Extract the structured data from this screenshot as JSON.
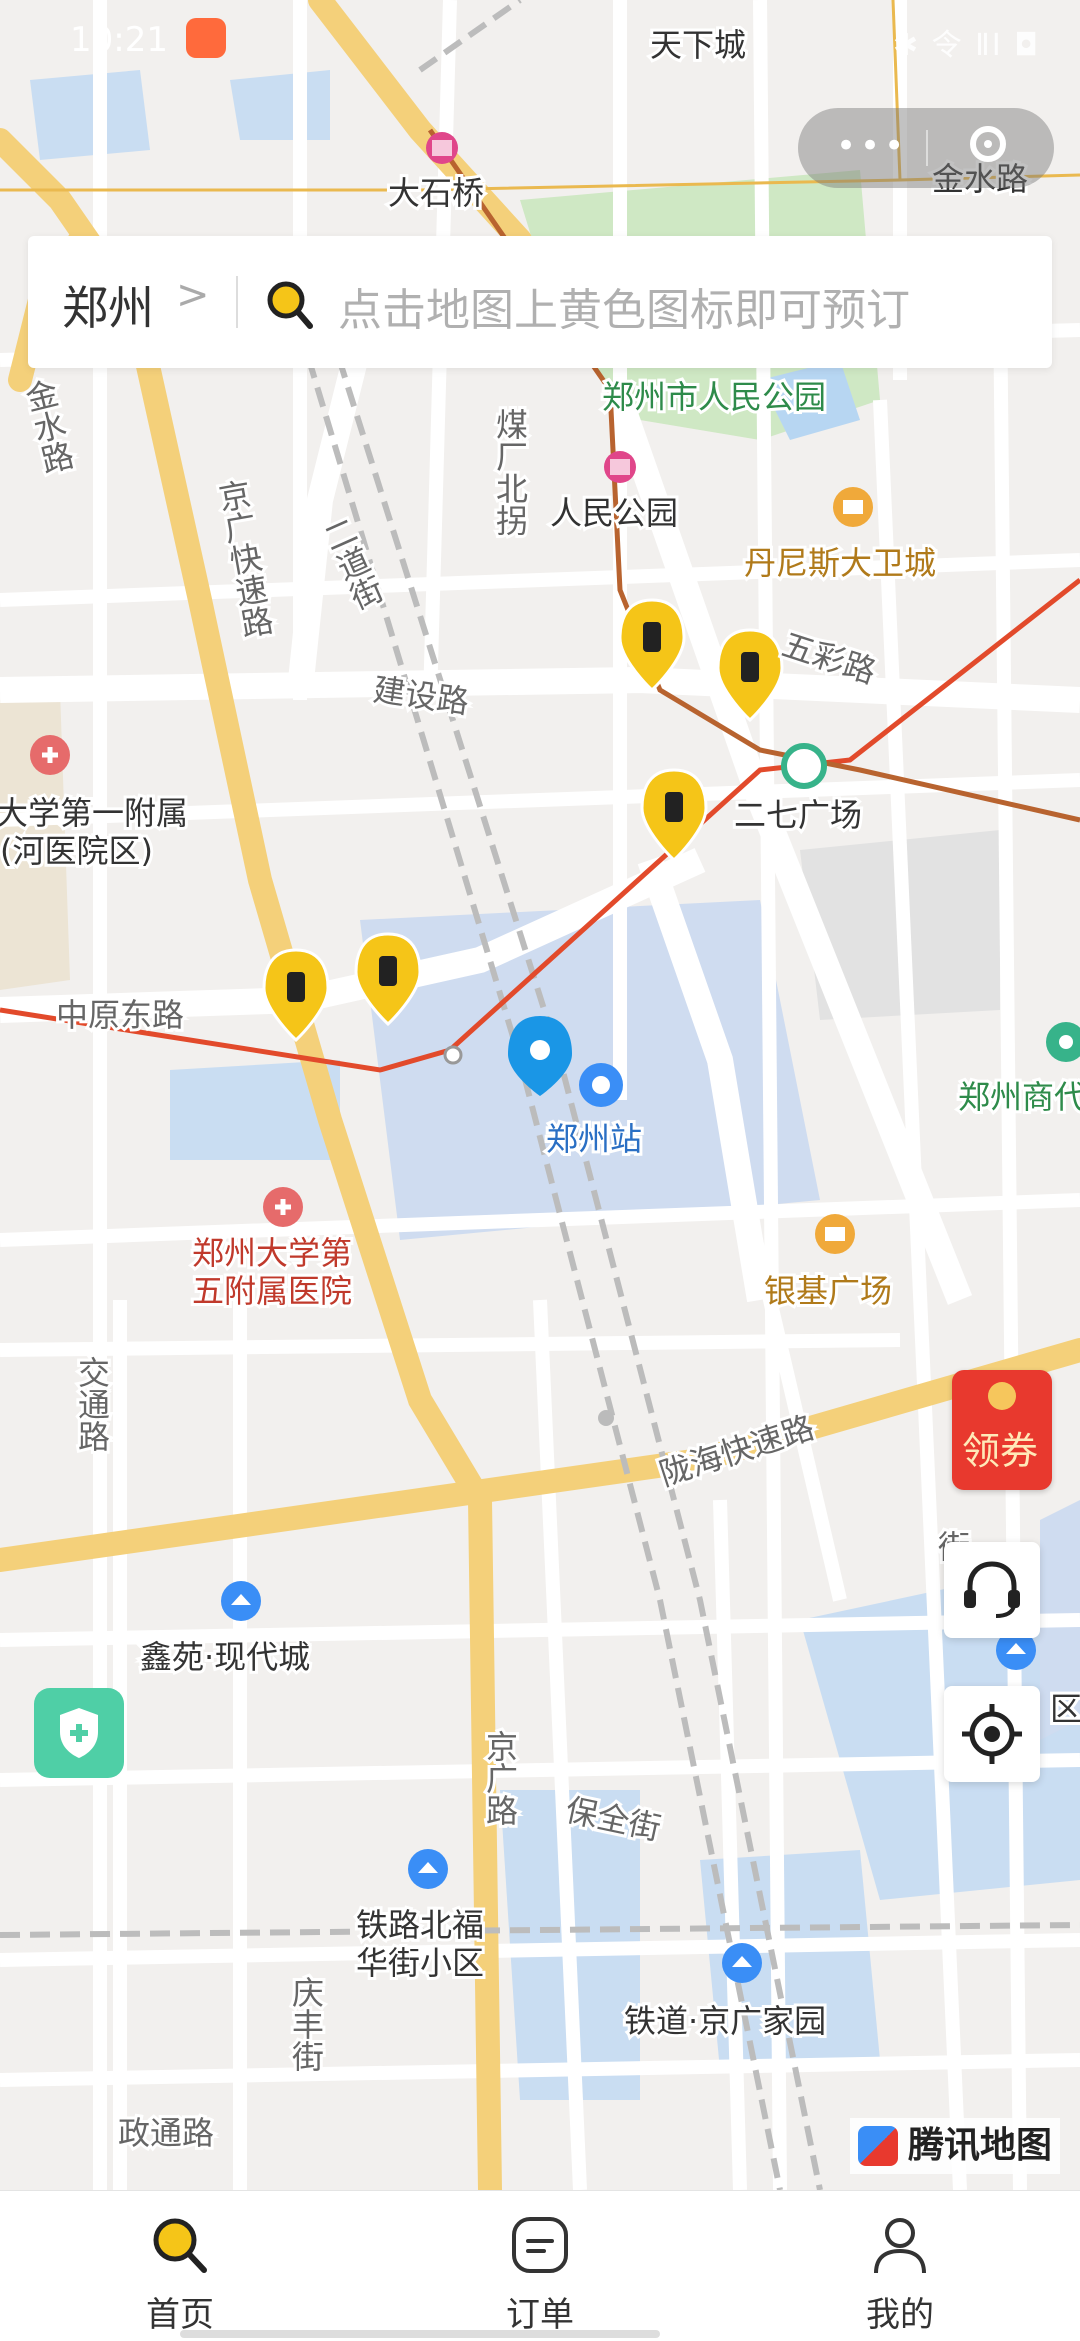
{
  "status_bar": {
    "time": "10:21",
    "right": "✱ 令 ⅡⅠ ◘"
  },
  "search": {
    "city": "郑州",
    "placeholder": "点击地图上黄色图标即可预订"
  },
  "map": {
    "labels": {
      "tianxiacheng": "天下城",
      "jinshuilu_top": "金水路",
      "dashiqiao": "大石桥",
      "renmin_park": "郑州市人民公园",
      "renmin_station": "人民公园",
      "meichang": "煤厂北拐",
      "jinshuilu_left": "金水路",
      "jingguang_expy": "京广快速路",
      "erdaojie": "二道街",
      "dennis": "丹尼斯大卫城",
      "wucailu": "五彩路",
      "jianshelu": "建设路",
      "erqi": "二七广场",
      "hospital1": "大学第一附属",
      "hospital1b": "(河医院区)",
      "zhongyuan": "中原东路",
      "zhengzhou_station": "郑州站",
      "zhengzhou_shang": "郑州商代",
      "hospital5": "郑州大学第",
      "hospital5b": "五附属医院",
      "yinji": "银基广场",
      "jiaotong": "交通路",
      "longhai": "陇海快速路",
      "xinyuan": "鑫苑·现代城",
      "jingguang_rd": "京广路",
      "baoquan": "保全街",
      "tielu1": "铁路北福",
      "tielu2": "华街小区",
      "qingfeng": "庆丰街",
      "tiedao": "铁道·京广家园",
      "zhengtong": "政通路",
      "jie_right": "街",
      "qu_right": "区"
    },
    "lockers_count": 5
  },
  "coupon": {
    "label": "领券"
  },
  "attribution": {
    "label": "腾讯地图"
  },
  "icons": {
    "service": "headset-icon",
    "locate": "locate-icon",
    "safety": "shield-icon",
    "locker": "luggage-icon",
    "location": "location-pin-icon"
  },
  "tabs": [
    {
      "label": "首页",
      "icon": "search-icon",
      "active": true
    },
    {
      "label": "订单",
      "icon": "order-icon",
      "active": false
    },
    {
      "label": "我的",
      "icon": "user-icon",
      "active": false
    }
  ],
  "colors": {
    "accent": "#f5c518",
    "metro": "#e24a2b",
    "highway": "#f4d07a",
    "pin": "#1a96e6"
  }
}
